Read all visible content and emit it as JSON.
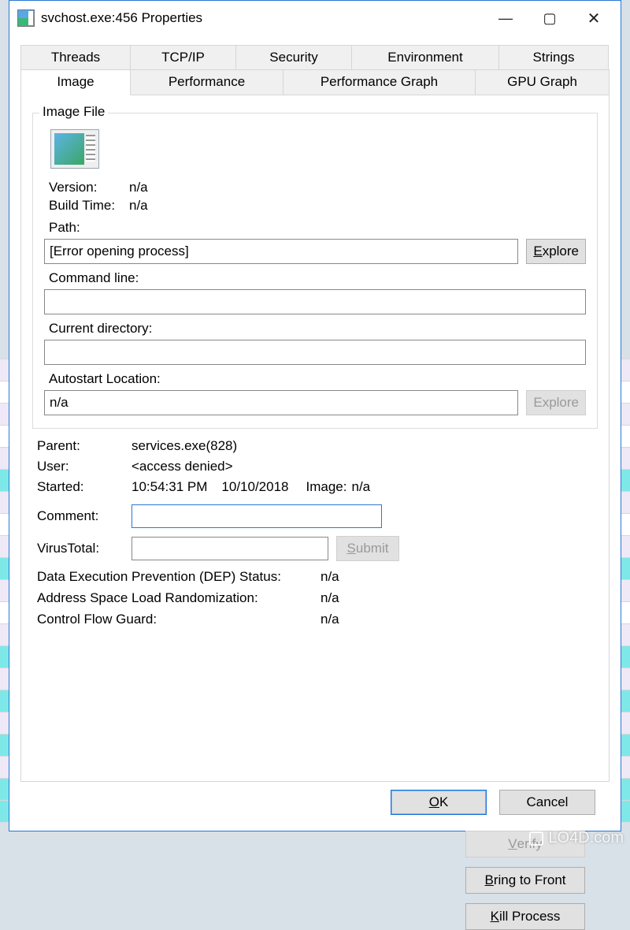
{
  "window": {
    "title": "svchost.exe:456 Properties"
  },
  "tabs": {
    "row1": [
      "Threads",
      "TCP/IP",
      "Security",
      "Environment",
      "Strings"
    ],
    "row2": [
      "Image",
      "Performance",
      "Performance Graph",
      "GPU Graph"
    ],
    "active": "Image"
  },
  "imageFile": {
    "legend": "Image File",
    "versionLabel": "Version:",
    "versionValue": "n/a",
    "buildLabel": "Build Time:",
    "buildValue": "n/a",
    "pathLabel": "Path:",
    "pathValue": "[Error opening process]",
    "exploreBtn": "Explore",
    "cmdLabel": "Command line:",
    "cmdValue": "",
    "curDirLabel": "Current directory:",
    "curDirValue": "",
    "autoLabel": "Autostart Location:",
    "autoValue": "n/a",
    "exploreBtn2": "Explore"
  },
  "info": {
    "parentLabel": "Parent:",
    "parentValue": "services.exe(828)",
    "userLabel": "User:",
    "userValue": "<access denied>",
    "startedLabel": "Started:",
    "startedTime": "10:54:31 PM",
    "startedDate": "10/10/2018",
    "imageLabel": "Image:",
    "imageValue": "n/a",
    "commentLabel": "Comment:",
    "commentValue": "",
    "vtLabel": "VirusTotal:",
    "vtValue": "",
    "submitBtn": "Submit"
  },
  "sideButtons": {
    "verify": "Verify",
    "bring": "Bring to Front",
    "kill": "Kill Process"
  },
  "status": {
    "depLabel": "Data Execution Prevention (DEP) Status:",
    "depValue": "n/a",
    "aslrLabel": "Address Space Load Randomization:",
    "aslrValue": "n/a",
    "cfgLabel": "Control Flow Guard:",
    "cfgValue": "n/a"
  },
  "footer": {
    "ok": "OK",
    "cancel": "Cancel"
  },
  "watermark": "LO4D.com"
}
